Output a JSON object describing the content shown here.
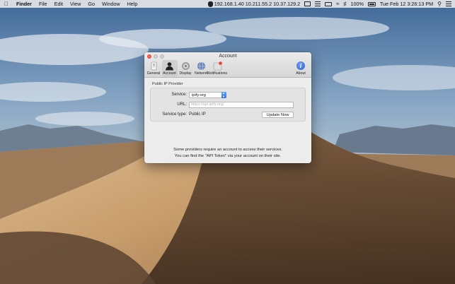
{
  "menubar": {
    "apple_icon": "apple-icon",
    "app_name": "Finder",
    "menus": [
      "File",
      "Edit",
      "View",
      "Go",
      "Window",
      "Help"
    ],
    "ip_status": "192.168.1.40 10.211.55.2 10.37.129.2",
    "battery_percent": "100%",
    "clock": "Tue Feb 12  3:26:13 PM"
  },
  "window": {
    "title": "Account",
    "toolbar": [
      {
        "label": "General",
        "icon": "general-icon"
      },
      {
        "label": "Account",
        "icon": "account-icon"
      },
      {
        "label": "Display",
        "icon": "display-icon"
      },
      {
        "label": "Network",
        "icon": "network-icon"
      },
      {
        "label": "Notifications",
        "icon": "notifications-icon"
      }
    ],
    "about_label": "About",
    "selected_tab": "Account"
  },
  "panel": {
    "group_title": "Public IP Provider",
    "service_label": "Service:",
    "service_value": "ipify.org",
    "url_label": "URL:",
    "url_placeholder": "https://api.ipify.org/",
    "service_type_label": "Service type:",
    "service_type_value": "Public IP",
    "update_button": "Update Now",
    "note_line1": "Some providers require an account to access their services.",
    "note_line2": "You can find the \"API Token\" via your account on their site."
  },
  "colors": {
    "close_button": "#fc5f57",
    "select_accent": "#2f74e6",
    "about_icon": "#2a5fcf"
  }
}
